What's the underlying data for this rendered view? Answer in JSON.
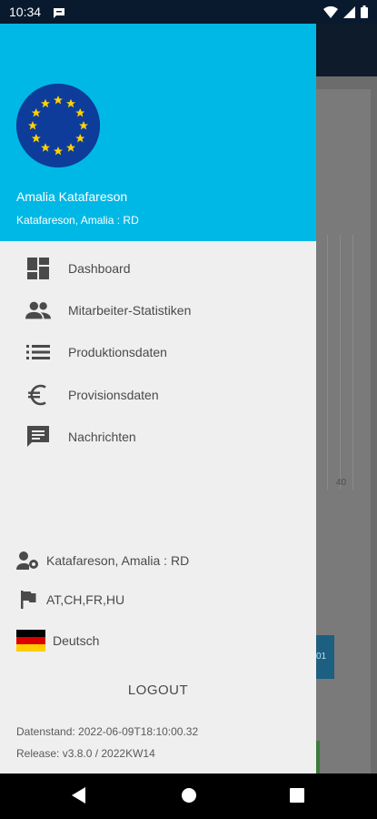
{
  "status_bar": {
    "time": "10:34",
    "left_icons": [
      "message-icon"
    ],
    "right_icons": [
      "wifi-icon",
      "signal-icon",
      "battery-icon"
    ]
  },
  "drawer": {
    "header": {
      "avatar_icon": "eu-flag-icon",
      "user_name": "Amalia Katafareson",
      "user_subtitle": "Katafareson, Amalia : RD",
      "color": "#00B8E6"
    },
    "menu": [
      {
        "icon": "dashboard-icon",
        "label": "Dashboard"
      },
      {
        "icon": "people-icon",
        "label": "Mitarbeiter-Statistiken"
      },
      {
        "icon": "list-icon",
        "label": "Produktionsdaten"
      },
      {
        "icon": "euro-icon",
        "label": "Provisionsdaten"
      },
      {
        "icon": "message-icon",
        "label": "Nachrichten"
      }
    ],
    "user_settings_label": "Katafareson, Amalia : RD",
    "countries_label": "AT,CH,FR,HU",
    "language_label": "Deutsch",
    "logout_label": "LOGOUT",
    "info": {
      "datenstand": "Datenstand:  2022-06-09T18:10:00.32",
      "release": "Release:  v3.8.0 / 2022KW14"
    }
  },
  "background_app": {
    "tick_label": "40",
    "button_fragment": "01"
  },
  "nav_bar": {
    "buttons": [
      "back-icon",
      "home-icon",
      "recents-icon"
    ]
  }
}
